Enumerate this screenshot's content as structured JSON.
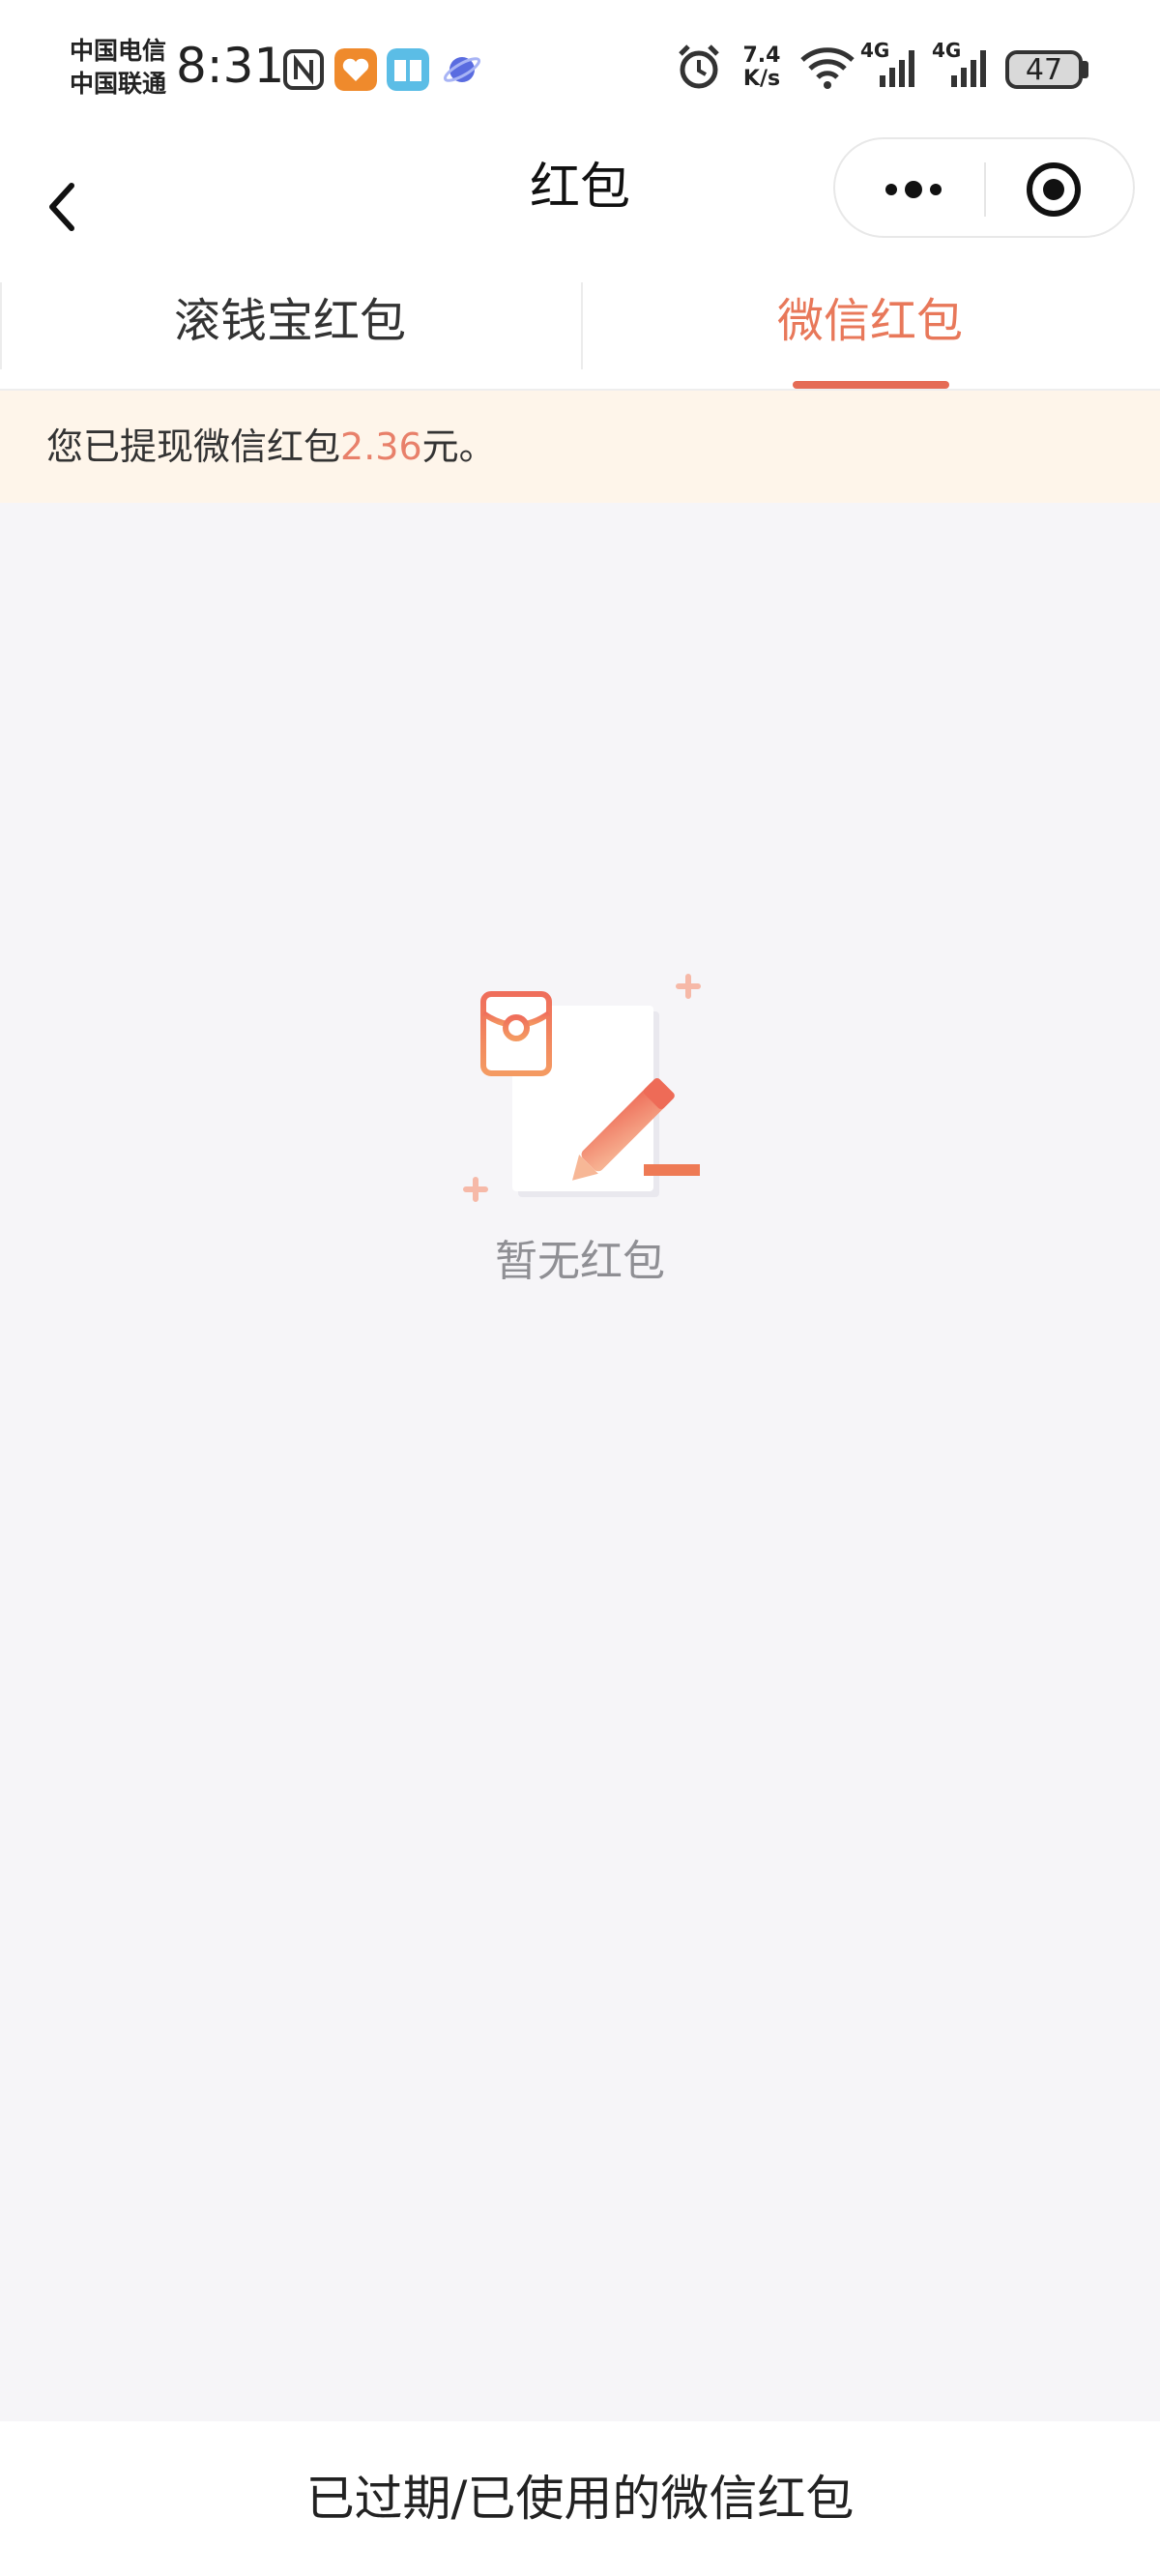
{
  "status_bar": {
    "carrier_1": "中国电信",
    "carrier_2": "中国联通",
    "time": "8:31",
    "net_speed_value": "7.4",
    "net_speed_unit": "K/s",
    "signal_1_label": "4G",
    "signal_2_label": "4G",
    "battery": "47",
    "icons": [
      "nfc-icon",
      "orange-app-icon",
      "book-app-icon",
      "planet-app-icon",
      "alarm-icon",
      "wifi-icon",
      "signal-icon",
      "battery-icon"
    ]
  },
  "nav": {
    "title": "红包",
    "back_icon": "chevron-left-icon",
    "more_icon": "more-dots-icon",
    "close_icon": "target-circle-icon"
  },
  "tabs": [
    {
      "label": "滚钱宝红包",
      "active": false
    },
    {
      "label": "微信红包",
      "active": true
    }
  ],
  "notice": {
    "prefix": "您已提现微信红包",
    "amount": "2.36",
    "suffix": "元。"
  },
  "empty_state": {
    "text": "暂无红包",
    "icon": "empty-redpacket-illustration"
  },
  "bottom": {
    "link_label": "已过期/已使用的微信红包"
  },
  "colors": {
    "accent": "#e8785a",
    "tab_underline": "#e56b55",
    "notice_bg": "#fef5ea",
    "page_bg": "#f6f5f8"
  }
}
